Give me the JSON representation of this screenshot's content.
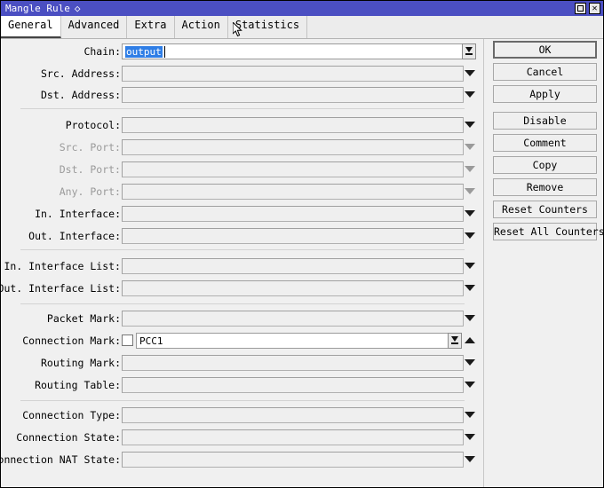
{
  "window": {
    "title": "Mangle Rule",
    "title_marker": "◇",
    "buttons": {
      "maximize": "maximize-restore",
      "close": "✕"
    }
  },
  "tabs": [
    {
      "label": "General",
      "active": true
    },
    {
      "label": "Advanced",
      "active": false
    },
    {
      "label": "Extra",
      "active": false
    },
    {
      "label": "Action",
      "active": false
    },
    {
      "label": "Statistics",
      "active": false
    }
  ],
  "form": {
    "rows": [
      {
        "label": "Chain:",
        "value": "output",
        "state": "active",
        "control": "combo-edit",
        "selected": true
      },
      {
        "label": "Src. Address:",
        "value": "",
        "state": "enabled",
        "control": "combo"
      },
      {
        "label": "Dst. Address:",
        "value": "",
        "state": "enabled",
        "control": "combo"
      },
      {
        "label": "Protocol:",
        "value": "",
        "state": "enabled",
        "control": "combo"
      },
      {
        "label": "Src. Port:",
        "value": "",
        "state": "disabled",
        "control": "combo"
      },
      {
        "label": "Dst. Port:",
        "value": "",
        "state": "disabled",
        "control": "combo"
      },
      {
        "label": "Any. Port:",
        "value": "",
        "state": "disabled",
        "control": "combo"
      },
      {
        "label": "In. Interface:",
        "value": "",
        "state": "enabled",
        "control": "combo"
      },
      {
        "label": "Out. Interface:",
        "value": "",
        "state": "enabled",
        "control": "combo"
      },
      {
        "label": "In. Interface List:",
        "value": "",
        "state": "enabled",
        "control": "combo"
      },
      {
        "label": "Out. Interface List:",
        "value": "",
        "state": "enabled",
        "control": "combo"
      },
      {
        "label": "Packet Mark:",
        "value": "",
        "state": "enabled",
        "control": "combo"
      },
      {
        "label": "Connection Mark:",
        "value": "PCC1",
        "state": "active",
        "control": "combo-edit-check",
        "checkbox": false,
        "arrow": "up"
      },
      {
        "label": "Routing Mark:",
        "value": "",
        "state": "enabled",
        "control": "combo"
      },
      {
        "label": "Routing Table:",
        "value": "",
        "state": "enabled",
        "control": "combo"
      },
      {
        "label": "Connection Type:",
        "value": "",
        "state": "enabled",
        "control": "combo"
      },
      {
        "label": "Connection State:",
        "value": "",
        "state": "enabled",
        "control": "combo"
      },
      {
        "label": "Connection NAT State:",
        "value": "",
        "state": "enabled",
        "control": "combo"
      }
    ]
  },
  "actions": [
    {
      "label": "OK",
      "default": true
    },
    {
      "label": "Cancel",
      "default": false
    },
    {
      "label": "Apply",
      "default": false
    },
    {
      "label": "Disable",
      "default": false
    },
    {
      "label": "Comment",
      "default": false
    },
    {
      "label": "Copy",
      "default": false
    },
    {
      "label": "Remove",
      "default": false
    },
    {
      "label": "Reset Counters",
      "default": false
    },
    {
      "label": "Reset All Counters",
      "default": false
    }
  ],
  "colors": {
    "titlebar": "#4b4fc2",
    "selection": "#2f7ee6",
    "surface": "#f0f0f0",
    "disabled_text": "#9a9a9a"
  }
}
